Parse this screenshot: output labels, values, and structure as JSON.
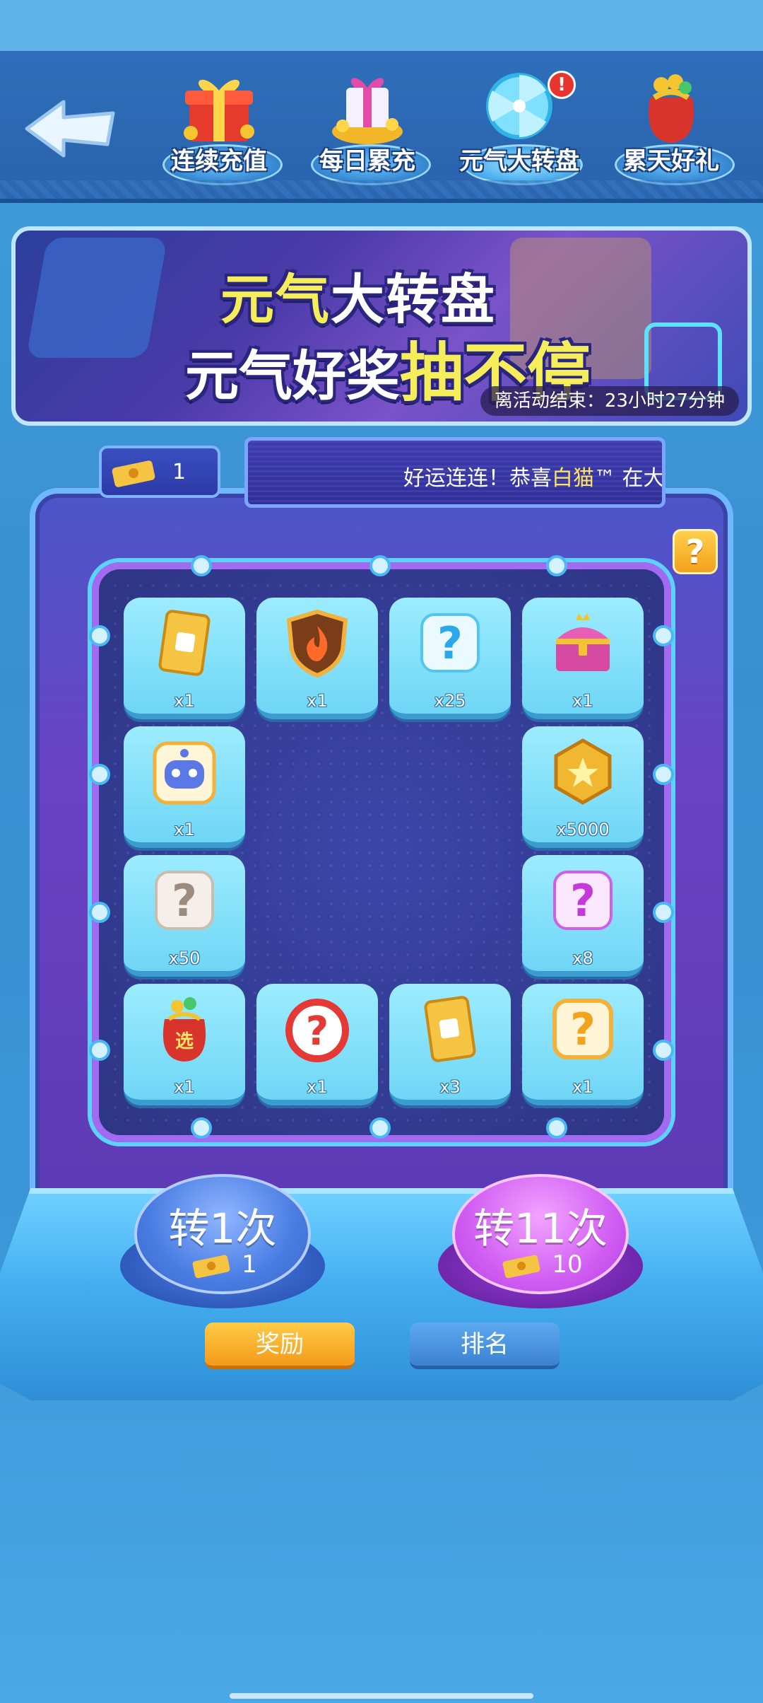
{
  "nav": {
    "items": [
      {
        "label": "连续充值",
        "icon": "gift-box-icon"
      },
      {
        "label": "每日累充",
        "icon": "gold-gift-icon"
      },
      {
        "label": "元气大转盘",
        "icon": "wheel-icon",
        "badge": "!"
      },
      {
        "label": "累天好礼",
        "icon": "lucky-bag-icon"
      }
    ]
  },
  "banner": {
    "title1_a": "元气",
    "title1_b": "大转盘",
    "title2_a": "元气好奖",
    "title2_b": "抽不停",
    "countdown": "离活动结束：23小时27分钟"
  },
  "tickets": {
    "count": "1"
  },
  "marquee": {
    "prefix": "好运连连！恭喜",
    "name": "白猫",
    "suffix": "™ 在大转"
  },
  "help_label": "?",
  "cells": [
    {
      "icon": "yellow-dice-card-icon",
      "qty": "x1"
    },
    {
      "icon": "fire-shield-icon",
      "qty": "x1"
    },
    {
      "icon": "blue-mystery-icon",
      "qty": "x25"
    },
    {
      "icon": "treasure-chest-icon",
      "qty": "x1"
    },
    {
      "icon": "robot-avatar-icon",
      "qty": "x1"
    },
    {
      "icon": "gold-coin-icon",
      "qty": "x5000"
    },
    {
      "icon": "white-mystery-icon",
      "qty": "x50"
    },
    {
      "icon": "pink-mystery-icon",
      "qty": "x8"
    },
    {
      "icon": "lucky-bag-icon",
      "qty": "x1"
    },
    {
      "icon": "red-mystery-icon",
      "qty": "x1"
    },
    {
      "icon": "yellow-dice-card-icon",
      "qty": "x3"
    },
    {
      "icon": "gold-mystery-icon",
      "qty": "x1"
    }
  ],
  "spin": {
    "one_label": "转1次",
    "one_cost": "1",
    "eleven_label": "转11次",
    "eleven_cost": "10"
  },
  "tabs": {
    "reward": "奖励",
    "rank": "排名"
  },
  "colors": {
    "accent": "#f39a19",
    "purple": "#6a42c4",
    "blue": "#3b95d6"
  }
}
